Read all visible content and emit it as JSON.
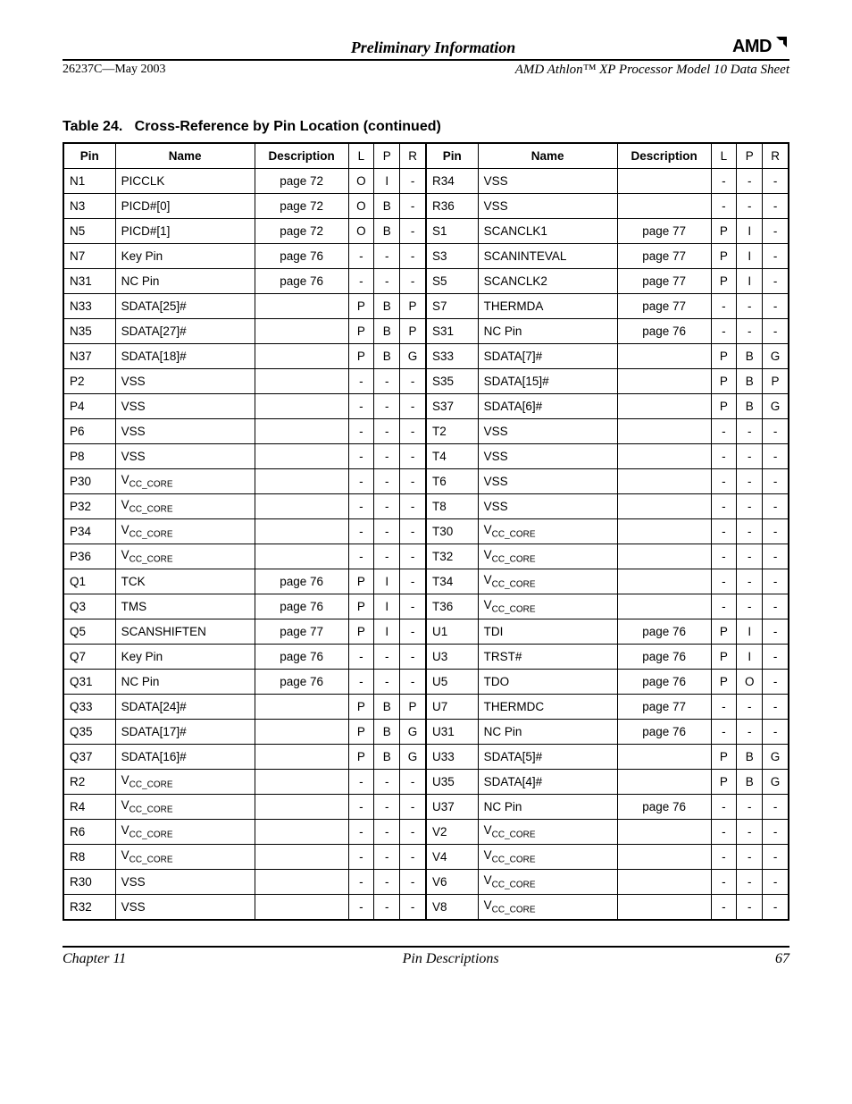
{
  "header": {
    "preliminary": "Preliminary Information",
    "logo_text": "AMD",
    "doc_id": "26237C—May 2003",
    "doc_title": "AMD Athlon™ XP Processor Model 10 Data Sheet"
  },
  "table": {
    "caption_prefix": "Table 24.",
    "caption_title": "Cross-Reference by Pin Location",
    "caption_suffix": "(continued)",
    "headers": {
      "pin": "Pin",
      "name": "Name",
      "desc": "Description",
      "l": "L",
      "p": "P",
      "r": "R"
    },
    "left_rows": [
      {
        "pin": "N1",
        "name": "PICCLK",
        "desc": "page 72",
        "l": "O",
        "p": "I",
        "r": "-"
      },
      {
        "pin": "N3",
        "name": "PICD#[0]",
        "desc": "page 72",
        "l": "O",
        "p": "B",
        "r": "-"
      },
      {
        "pin": "N5",
        "name": "PICD#[1]",
        "desc": "page 72",
        "l": "O",
        "p": "B",
        "r": "-"
      },
      {
        "pin": "N7",
        "name": "Key Pin",
        "desc": "page 76",
        "l": "-",
        "p": "-",
        "r": "-"
      },
      {
        "pin": "N31",
        "name": "NC Pin",
        "desc": "page 76",
        "l": "-",
        "p": "-",
        "r": "-"
      },
      {
        "pin": "N33",
        "name": "SDATA[25]#",
        "desc": "",
        "l": "P",
        "p": "B",
        "r": "P"
      },
      {
        "pin": "N35",
        "name": "SDATA[27]#",
        "desc": "",
        "l": "P",
        "p": "B",
        "r": "P"
      },
      {
        "pin": "N37",
        "name": "SDATA[18]#",
        "desc": "",
        "l": "P",
        "p": "B",
        "r": "G"
      },
      {
        "pin": "P2",
        "name": "VSS",
        "desc": "",
        "l": "-",
        "p": "-",
        "r": "-"
      },
      {
        "pin": "P4",
        "name": "VSS",
        "desc": "",
        "l": "-",
        "p": "-",
        "r": "-"
      },
      {
        "pin": "P6",
        "name": "VSS",
        "desc": "",
        "l": "-",
        "p": "-",
        "r": "-"
      },
      {
        "pin": "P8",
        "name": "VSS",
        "desc": "",
        "l": "-",
        "p": "-",
        "r": "-"
      },
      {
        "pin": "P30",
        "name": "VCC_CORE",
        "desc": "",
        "l": "-",
        "p": "-",
        "r": "-"
      },
      {
        "pin": "P32",
        "name": "VCC_CORE",
        "desc": "",
        "l": "-",
        "p": "-",
        "r": "-"
      },
      {
        "pin": "P34",
        "name": "VCC_CORE",
        "desc": "",
        "l": "-",
        "p": "-",
        "r": "-"
      },
      {
        "pin": "P36",
        "name": "VCC_CORE",
        "desc": "",
        "l": "-",
        "p": "-",
        "r": "-"
      },
      {
        "pin": "Q1",
        "name": "TCK",
        "desc": "page 76",
        "l": "P",
        "p": "I",
        "r": "-"
      },
      {
        "pin": "Q3",
        "name": "TMS",
        "desc": "page 76",
        "l": "P",
        "p": "I",
        "r": "-"
      },
      {
        "pin": "Q5",
        "name": "SCANSHIFTEN",
        "desc": "page 77",
        "l": "P",
        "p": "I",
        "r": "-"
      },
      {
        "pin": "Q7",
        "name": "Key Pin",
        "desc": "page 76",
        "l": "-",
        "p": "-",
        "r": "-"
      },
      {
        "pin": "Q31",
        "name": "NC Pin",
        "desc": "page 76",
        "l": "-",
        "p": "-",
        "r": "-"
      },
      {
        "pin": "Q33",
        "name": "SDATA[24]#",
        "desc": "",
        "l": "P",
        "p": "B",
        "r": "P"
      },
      {
        "pin": "Q35",
        "name": "SDATA[17]#",
        "desc": "",
        "l": "P",
        "p": "B",
        "r": "G"
      },
      {
        "pin": "Q37",
        "name": "SDATA[16]#",
        "desc": "",
        "l": "P",
        "p": "B",
        "r": "G"
      },
      {
        "pin": "R2",
        "name": "VCC_CORE",
        "desc": "",
        "l": "-",
        "p": "-",
        "r": "-"
      },
      {
        "pin": "R4",
        "name": "VCC_CORE",
        "desc": "",
        "l": "-",
        "p": "-",
        "r": "-"
      },
      {
        "pin": "R6",
        "name": "VCC_CORE",
        "desc": "",
        "l": "-",
        "p": "-",
        "r": "-"
      },
      {
        "pin": "R8",
        "name": "VCC_CORE",
        "desc": "",
        "l": "-",
        "p": "-",
        "r": "-"
      },
      {
        "pin": "R30",
        "name": "VSS",
        "desc": "",
        "l": "-",
        "p": "-",
        "r": "-"
      },
      {
        "pin": "R32",
        "name": "VSS",
        "desc": "",
        "l": "-",
        "p": "-",
        "r": "-"
      }
    ],
    "right_rows": [
      {
        "pin": "R34",
        "name": "VSS",
        "desc": "",
        "l": "-",
        "p": "-",
        "r": "-"
      },
      {
        "pin": "R36",
        "name": "VSS",
        "desc": "",
        "l": "-",
        "p": "-",
        "r": "-"
      },
      {
        "pin": "S1",
        "name": "SCANCLK1",
        "desc": "page 77",
        "l": "P",
        "p": "I",
        "r": "-"
      },
      {
        "pin": "S3",
        "name": "SCANINTEVAL",
        "desc": "page 77",
        "l": "P",
        "p": "I",
        "r": "-"
      },
      {
        "pin": "S5",
        "name": "SCANCLK2",
        "desc": "page 77",
        "l": "P",
        "p": "I",
        "r": "-"
      },
      {
        "pin": "S7",
        "name": "THERMDA",
        "desc": "page 77",
        "l": "-",
        "p": "-",
        "r": "-"
      },
      {
        "pin": "S31",
        "name": "NC Pin",
        "desc": "page 76",
        "l": "-",
        "p": "-",
        "r": "-"
      },
      {
        "pin": "S33",
        "name": "SDATA[7]#",
        "desc": "",
        "l": "P",
        "p": "B",
        "r": "G"
      },
      {
        "pin": "S35",
        "name": "SDATA[15]#",
        "desc": "",
        "l": "P",
        "p": "B",
        "r": "P"
      },
      {
        "pin": "S37",
        "name": "SDATA[6]#",
        "desc": "",
        "l": "P",
        "p": "B",
        "r": "G"
      },
      {
        "pin": "T2",
        "name": "VSS",
        "desc": "",
        "l": "-",
        "p": "-",
        "r": "-"
      },
      {
        "pin": "T4",
        "name": "VSS",
        "desc": "",
        "l": "-",
        "p": "-",
        "r": "-"
      },
      {
        "pin": "T6",
        "name": "VSS",
        "desc": "",
        "l": "-",
        "p": "-",
        "r": "-"
      },
      {
        "pin": "T8",
        "name": "VSS",
        "desc": "",
        "l": "-",
        "p": "-",
        "r": "-"
      },
      {
        "pin": "T30",
        "name": "VCC_CORE",
        "desc": "",
        "l": "-",
        "p": "-",
        "r": "-"
      },
      {
        "pin": "T32",
        "name": "VCC_CORE",
        "desc": "",
        "l": "-",
        "p": "-",
        "r": "-"
      },
      {
        "pin": "T34",
        "name": "VCC_CORE",
        "desc": "",
        "l": "-",
        "p": "-",
        "r": "-"
      },
      {
        "pin": "T36",
        "name": "VCC_CORE",
        "desc": "",
        "l": "-",
        "p": "-",
        "r": "-"
      },
      {
        "pin": "U1",
        "name": "TDI",
        "desc": "page 76",
        "l": "P",
        "p": "I",
        "r": "-"
      },
      {
        "pin": "U3",
        "name": "TRST#",
        "desc": "page 76",
        "l": "P",
        "p": "I",
        "r": "-"
      },
      {
        "pin": "U5",
        "name": "TDO",
        "desc": "page 76",
        "l": "P",
        "p": "O",
        "r": "-"
      },
      {
        "pin": "U7",
        "name": "THERMDC",
        "desc": "page 77",
        "l": "-",
        "p": "-",
        "r": "-"
      },
      {
        "pin": "U31",
        "name": "NC Pin",
        "desc": "page 76",
        "l": "-",
        "p": "-",
        "r": "-"
      },
      {
        "pin": "U33",
        "name": "SDATA[5]#",
        "desc": "",
        "l": "P",
        "p": "B",
        "r": "G"
      },
      {
        "pin": "U35",
        "name": "SDATA[4]#",
        "desc": "",
        "l": "P",
        "p": "B",
        "r": "G"
      },
      {
        "pin": "U37",
        "name": "NC Pin",
        "desc": "page 76",
        "l": "-",
        "p": "-",
        "r": "-"
      },
      {
        "pin": "V2",
        "name": "VCC_CORE",
        "desc": "",
        "l": "-",
        "p": "-",
        "r": "-"
      },
      {
        "pin": "V4",
        "name": "VCC_CORE",
        "desc": "",
        "l": "-",
        "p": "-",
        "r": "-"
      },
      {
        "pin": "V6",
        "name": "VCC_CORE",
        "desc": "",
        "l": "-",
        "p": "-",
        "r": "-"
      },
      {
        "pin": "V8",
        "name": "VCC_CORE",
        "desc": "",
        "l": "-",
        "p": "-",
        "r": "-"
      }
    ]
  },
  "footer": {
    "chapter": "Chapter 11",
    "section": "Pin Descriptions",
    "page": "67"
  }
}
